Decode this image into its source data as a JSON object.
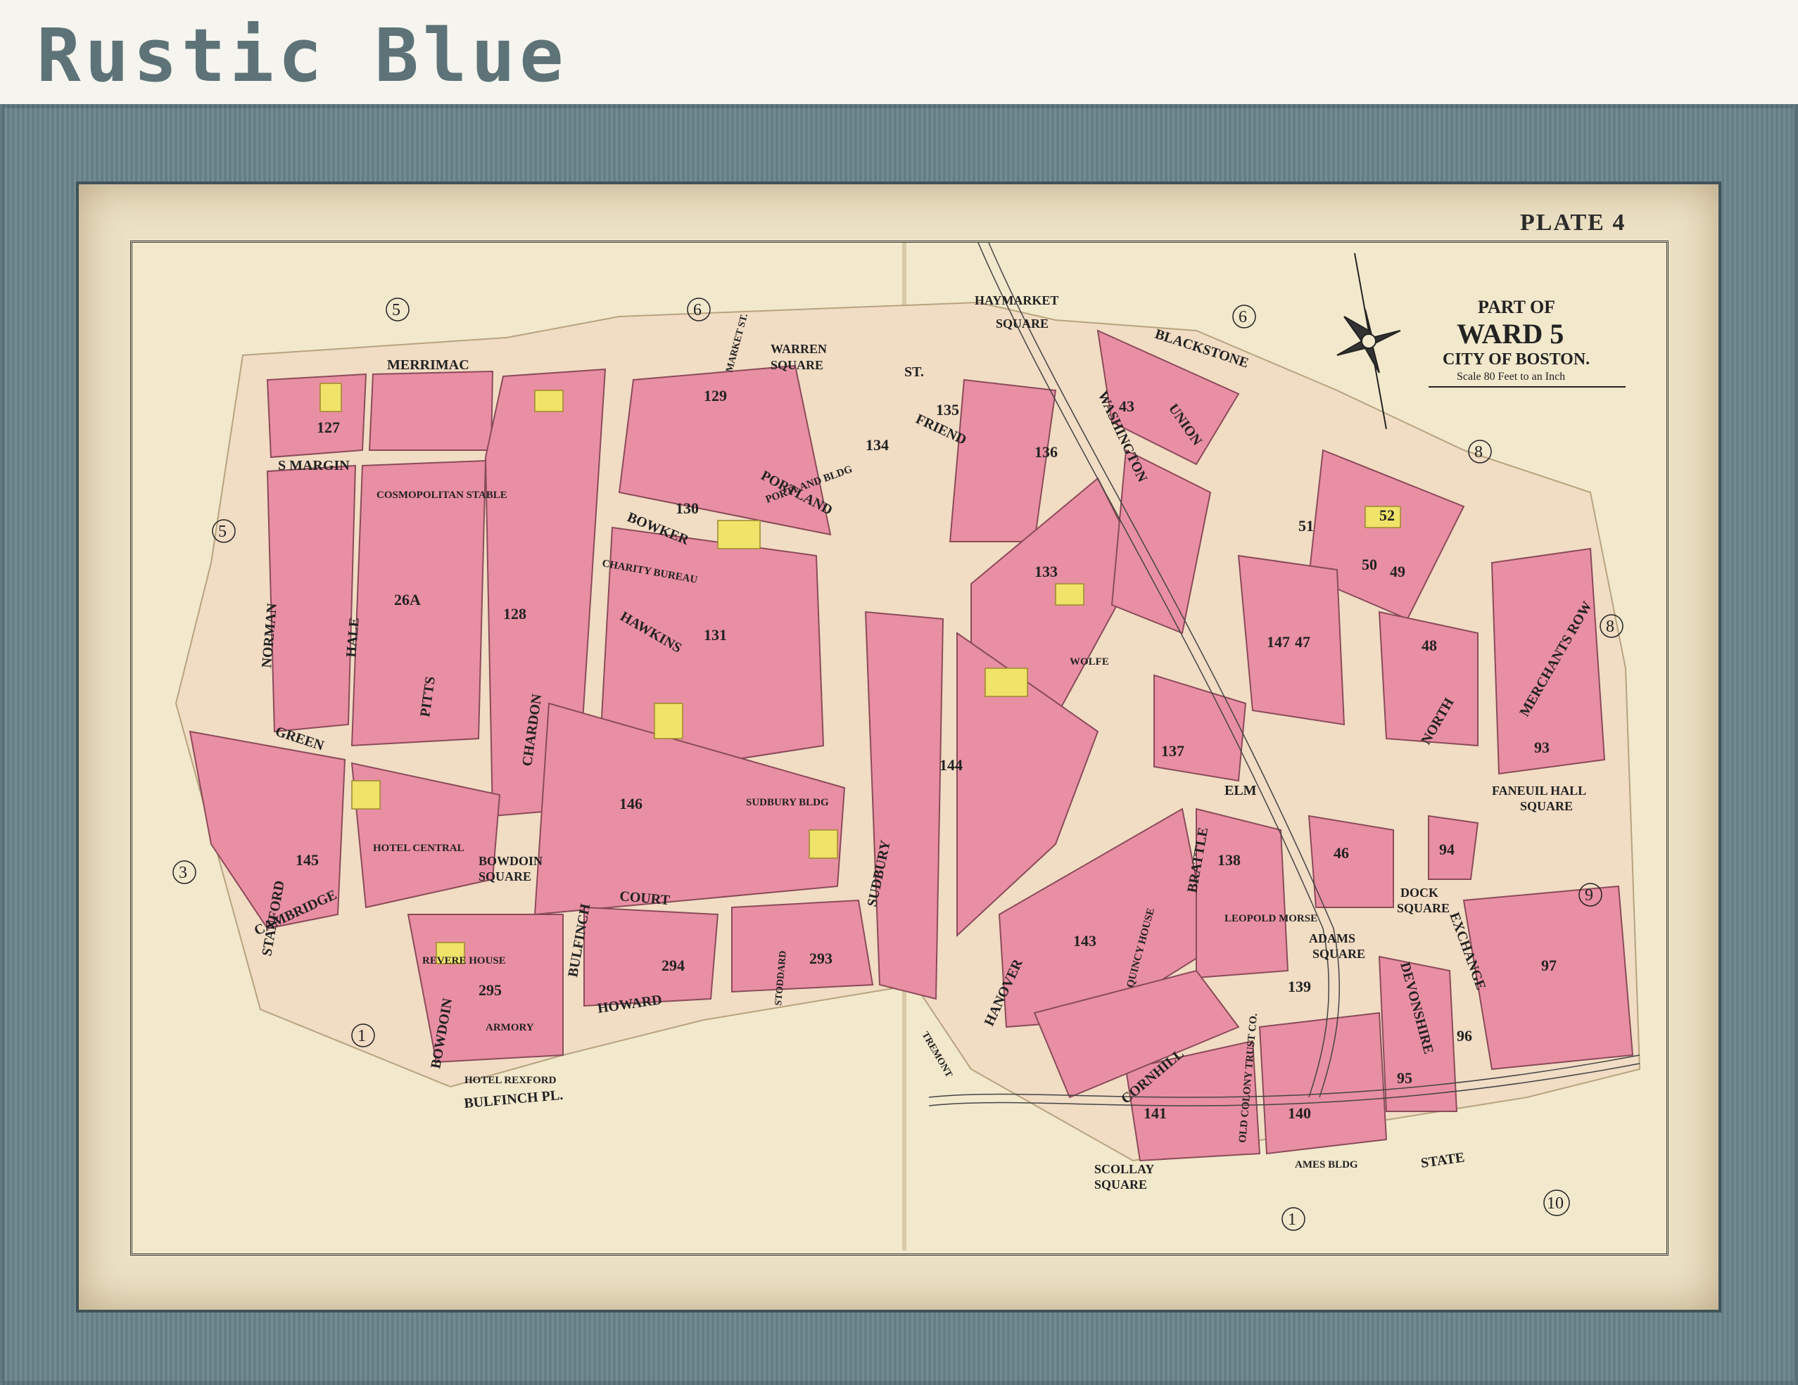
{
  "banner": {
    "title": "Rustic Blue"
  },
  "plate": "PLATE 4",
  "legend": {
    "line1": "PART OF",
    "line2": "WARD 5",
    "line3": "CITY OF BOSTON.",
    "scale": "Scale 80 Feet to an Inch"
  },
  "streets": {
    "merrimac": "MERRIMAC",
    "st": "ST.",
    "s_margin": "S MARGIN",
    "portland": "PORTLAND",
    "friend": "FRIEND",
    "bowker": "BOWKER",
    "hawkins": "HAWKINS",
    "green": "GREEN",
    "cambridge": "CAMBRIDGE",
    "court": "COURT",
    "howard": "HOWARD",
    "bulfinch": "BULFINCH",
    "bulfinch_pl": "BULFINCH PL.",
    "bowdoin": "BOWDOIN",
    "chardon": "CHARDON",
    "pitts": "PITTS",
    "hale": "HALE",
    "norman": "NORMAN",
    "stanford": "STANFORD",
    "sudbury": "SUDBURY",
    "hanover": "HANOVER",
    "washington": "WASHINGTON",
    "union": "UNION",
    "blackstone": "BLACKSTONE",
    "elm": "ELM",
    "brattle": "BRATTLE",
    "cornhill": "CORNHILL",
    "devonshire": "DEVONSHIRE",
    "exchange": "EXCHANGE",
    "state": "STATE",
    "north": "NORTH",
    "merchants_row": "MERCHANTS ROW",
    "tremont": "TREMONT",
    "stoddard": "STODDARD",
    "market": "MARKET ST."
  },
  "squares": {
    "haymarket": "HAYMARKET",
    "haymarket_sq": "SQUARE",
    "warren": "WARREN",
    "warren_sq": "SQUARE",
    "bowdoin": "BOWDOIN",
    "bowdoin_sq": "SQUARE",
    "scollay": "SCOLLAY",
    "scollay_sq": "SQUARE",
    "adams": "ADAMS",
    "adams_sq": "SQUARE",
    "dock": "DOCK",
    "dock_sq": "SQUARE",
    "faneuil": "FANEUIL HALL",
    "faneuil_sq": "SQUARE"
  },
  "ward_markers": [
    "5",
    "6",
    "6",
    "5",
    "8",
    "8",
    "3",
    "9",
    "1",
    "1",
    "10"
  ],
  "block_numbers": [
    "127",
    "128",
    "129",
    "130",
    "131",
    "133",
    "134",
    "135",
    "136",
    "137",
    "138",
    "139",
    "140",
    "141",
    "143",
    "144",
    "145",
    "146",
    "147",
    "26A",
    "295",
    "294",
    "293",
    "43",
    "46",
    "47",
    "48",
    "49",
    "50",
    "51",
    "52",
    "93",
    "94",
    "95",
    "96",
    "97"
  ],
  "buildings": {
    "cosmopolitan": "COSMOPOLITAN STABLE",
    "charity": "CHARITY BUREAU",
    "revere": "REVERE HOUSE",
    "hotel_rexford": "HOTEL REXFORD",
    "armory": "ARMORY",
    "sudbury_bldg": "SUDBURY BLDG",
    "quincy": "QUINCY HOUSE",
    "ames": "AMES BLDG",
    "old_colony": "OLD COLONY TRUST CO.",
    "wolfe": "WOLFE",
    "leopold": "LEOPOLD MORSE",
    "portland_bldg": "PORTLAND BLDG",
    "hotel_central": "HOTEL CENTRAL"
  },
  "colors": {
    "frame": "#6c858c",
    "mat": "#ece1c4",
    "paper": "#f2e8cc",
    "block": "#e98fa3",
    "yellow": "#efe36a",
    "street": "#f1dcc4",
    "banner_text": "#5d7378"
  }
}
